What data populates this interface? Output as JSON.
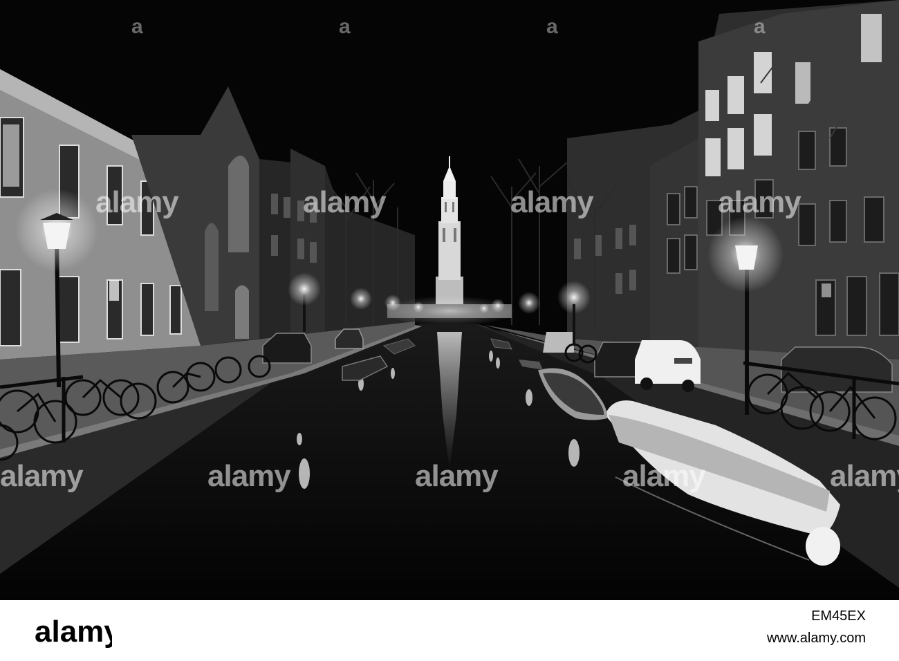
{
  "photo": {
    "description_subject": "canal-night-scene",
    "tower": "church-tower"
  },
  "watermark": {
    "word": "alamy",
    "tiles": [
      "a",
      "a",
      "a",
      "a"
    ]
  },
  "footer": {
    "brand": "alamy",
    "image_id": "EM45EX",
    "url": "www.alamy.com"
  }
}
